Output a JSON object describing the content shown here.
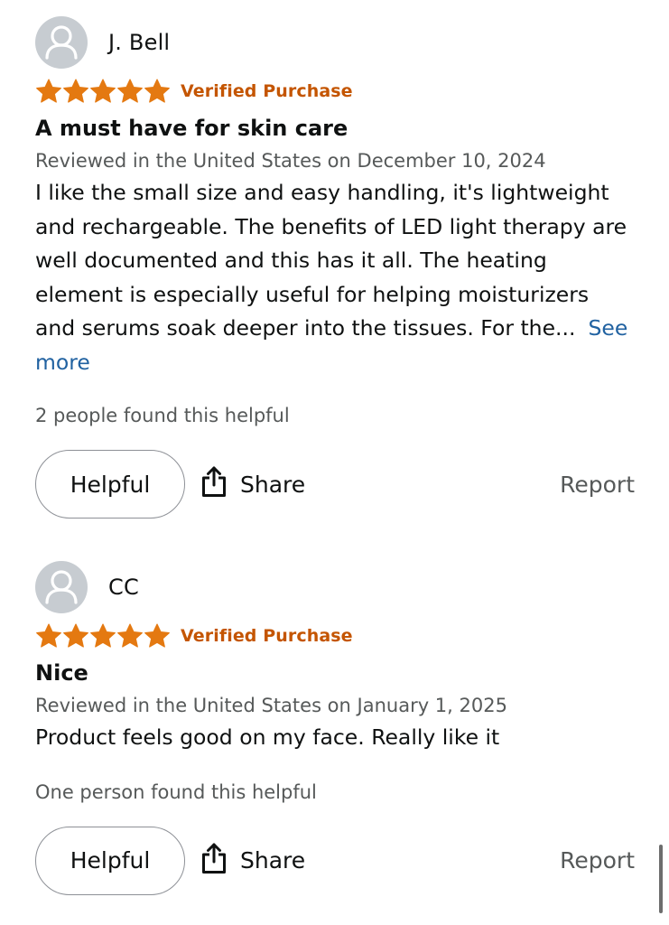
{
  "reviews": [
    {
      "reviewer": "J. Bell",
      "rating": 5,
      "badge": "Verified Purchase",
      "title": "A must have for skin care",
      "date_line": "Reviewed in the United States on December 10, 2024",
      "body": "I like the small size and easy handling, it's lightweight and rechargeable. The benefits of LED light therapy are well documented and this has it all. The heating element is especially useful for helping moisturizers and serums soak deeper into the tissues. For the...",
      "see_more": "See more",
      "helpful_count": "2 people found this helpful",
      "helpful_label": "Helpful",
      "share_label": "Share",
      "report_label": "Report"
    },
    {
      "reviewer": "CC",
      "rating": 5,
      "badge": "Verified Purchase",
      "title": "Nice",
      "date_line": "Reviewed in the United States on January 1, 2025",
      "body": "Product feels good on my face. Really like it",
      "helpful_count": "One person found this helpful",
      "helpful_label": "Helpful",
      "share_label": "Share",
      "report_label": "Report"
    }
  ],
  "colors": {
    "star": "#e47911",
    "verified": "#c45500",
    "link": "#2162a1",
    "muted": "#565959",
    "avatar_bg": "#c7ccd1"
  },
  "icons": {
    "avatar": "person-silhouette-icon",
    "star": "star-icon",
    "share": "share-icon"
  }
}
